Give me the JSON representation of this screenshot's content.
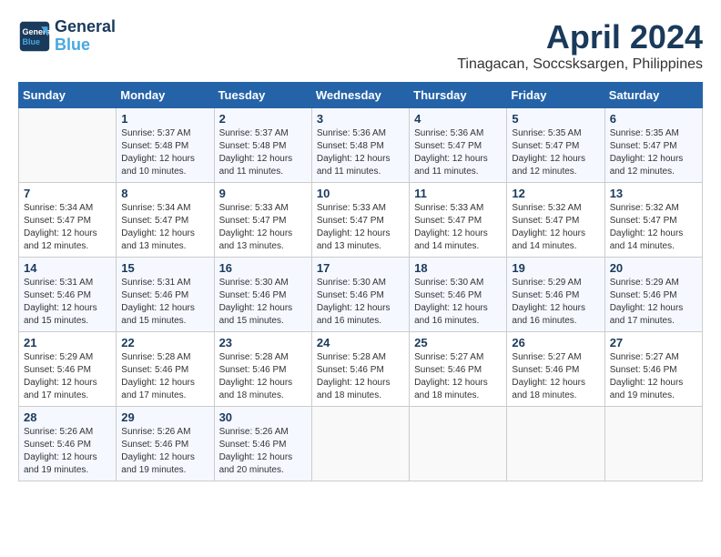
{
  "header": {
    "logo_line1": "General",
    "logo_line2": "Blue",
    "title": "April 2024",
    "subtitle": "Tinagacan, Soccsksargen, Philippines"
  },
  "calendar": {
    "weekdays": [
      "Sunday",
      "Monday",
      "Tuesday",
      "Wednesday",
      "Thursday",
      "Friday",
      "Saturday"
    ],
    "weeks": [
      [
        {
          "day": "",
          "info": ""
        },
        {
          "day": "1",
          "info": "Sunrise: 5:37 AM\nSunset: 5:48 PM\nDaylight: 12 hours\nand 10 minutes."
        },
        {
          "day": "2",
          "info": "Sunrise: 5:37 AM\nSunset: 5:48 PM\nDaylight: 12 hours\nand 11 minutes."
        },
        {
          "day": "3",
          "info": "Sunrise: 5:36 AM\nSunset: 5:48 PM\nDaylight: 12 hours\nand 11 minutes."
        },
        {
          "day": "4",
          "info": "Sunrise: 5:36 AM\nSunset: 5:47 PM\nDaylight: 12 hours\nand 11 minutes."
        },
        {
          "day": "5",
          "info": "Sunrise: 5:35 AM\nSunset: 5:47 PM\nDaylight: 12 hours\nand 12 minutes."
        },
        {
          "day": "6",
          "info": "Sunrise: 5:35 AM\nSunset: 5:47 PM\nDaylight: 12 hours\nand 12 minutes."
        }
      ],
      [
        {
          "day": "7",
          "info": "Sunrise: 5:34 AM\nSunset: 5:47 PM\nDaylight: 12 hours\nand 12 minutes."
        },
        {
          "day": "8",
          "info": "Sunrise: 5:34 AM\nSunset: 5:47 PM\nDaylight: 12 hours\nand 13 minutes."
        },
        {
          "day": "9",
          "info": "Sunrise: 5:33 AM\nSunset: 5:47 PM\nDaylight: 12 hours\nand 13 minutes."
        },
        {
          "day": "10",
          "info": "Sunrise: 5:33 AM\nSunset: 5:47 PM\nDaylight: 12 hours\nand 13 minutes."
        },
        {
          "day": "11",
          "info": "Sunrise: 5:33 AM\nSunset: 5:47 PM\nDaylight: 12 hours\nand 14 minutes."
        },
        {
          "day": "12",
          "info": "Sunrise: 5:32 AM\nSunset: 5:47 PM\nDaylight: 12 hours\nand 14 minutes."
        },
        {
          "day": "13",
          "info": "Sunrise: 5:32 AM\nSunset: 5:47 PM\nDaylight: 12 hours\nand 14 minutes."
        }
      ],
      [
        {
          "day": "14",
          "info": "Sunrise: 5:31 AM\nSunset: 5:46 PM\nDaylight: 12 hours\nand 15 minutes."
        },
        {
          "day": "15",
          "info": "Sunrise: 5:31 AM\nSunset: 5:46 PM\nDaylight: 12 hours\nand 15 minutes."
        },
        {
          "day": "16",
          "info": "Sunrise: 5:30 AM\nSunset: 5:46 PM\nDaylight: 12 hours\nand 15 minutes."
        },
        {
          "day": "17",
          "info": "Sunrise: 5:30 AM\nSunset: 5:46 PM\nDaylight: 12 hours\nand 16 minutes."
        },
        {
          "day": "18",
          "info": "Sunrise: 5:30 AM\nSunset: 5:46 PM\nDaylight: 12 hours\nand 16 minutes."
        },
        {
          "day": "19",
          "info": "Sunrise: 5:29 AM\nSunset: 5:46 PM\nDaylight: 12 hours\nand 16 minutes."
        },
        {
          "day": "20",
          "info": "Sunrise: 5:29 AM\nSunset: 5:46 PM\nDaylight: 12 hours\nand 17 minutes."
        }
      ],
      [
        {
          "day": "21",
          "info": "Sunrise: 5:29 AM\nSunset: 5:46 PM\nDaylight: 12 hours\nand 17 minutes."
        },
        {
          "day": "22",
          "info": "Sunrise: 5:28 AM\nSunset: 5:46 PM\nDaylight: 12 hours\nand 17 minutes."
        },
        {
          "day": "23",
          "info": "Sunrise: 5:28 AM\nSunset: 5:46 PM\nDaylight: 12 hours\nand 18 minutes."
        },
        {
          "day": "24",
          "info": "Sunrise: 5:28 AM\nSunset: 5:46 PM\nDaylight: 12 hours\nand 18 minutes."
        },
        {
          "day": "25",
          "info": "Sunrise: 5:27 AM\nSunset: 5:46 PM\nDaylight: 12 hours\nand 18 minutes."
        },
        {
          "day": "26",
          "info": "Sunrise: 5:27 AM\nSunset: 5:46 PM\nDaylight: 12 hours\nand 18 minutes."
        },
        {
          "day": "27",
          "info": "Sunrise: 5:27 AM\nSunset: 5:46 PM\nDaylight: 12 hours\nand 19 minutes."
        }
      ],
      [
        {
          "day": "28",
          "info": "Sunrise: 5:26 AM\nSunset: 5:46 PM\nDaylight: 12 hours\nand 19 minutes."
        },
        {
          "day": "29",
          "info": "Sunrise: 5:26 AM\nSunset: 5:46 PM\nDaylight: 12 hours\nand 19 minutes."
        },
        {
          "day": "30",
          "info": "Sunrise: 5:26 AM\nSunset: 5:46 PM\nDaylight: 12 hours\nand 20 minutes."
        },
        {
          "day": "",
          "info": ""
        },
        {
          "day": "",
          "info": ""
        },
        {
          "day": "",
          "info": ""
        },
        {
          "day": "",
          "info": ""
        }
      ]
    ]
  }
}
